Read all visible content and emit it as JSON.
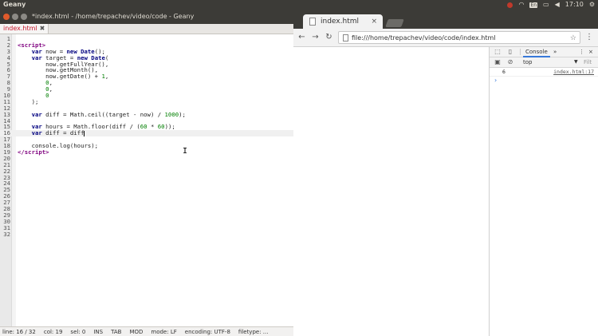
{
  "system": {
    "app_name": "Geany",
    "time": "17:10",
    "keyboard_layout": "En"
  },
  "geany": {
    "title": "*index.html - /home/trepachev/video/code - Geany",
    "tab_label": "index.html",
    "tab_close": "✖",
    "lines": [
      {
        "n": "1",
        "html": ""
      },
      {
        "n": "2",
        "html": "<span class='tagc'>&lt;script&gt;</span>"
      },
      {
        "n": "3",
        "html": "    <span class='kw'>var</span> now = <span class='kw'>new</span> <span class='kw'>Date</span>();"
      },
      {
        "n": "4",
        "html": "    <span class='kw'>var</span> target = <span class='kw'>new</span> <span class='kw'>Date</span>("
      },
      {
        "n": "5",
        "html": "        now.getFullYear(),"
      },
      {
        "n": "6",
        "html": "        now.getMonth(),"
      },
      {
        "n": "7",
        "html": "        now.getDate() + <span class='num'>1</span>,"
      },
      {
        "n": "8",
        "html": "        <span class='num'>0</span>,"
      },
      {
        "n": "9",
        "html": "        <span class='num'>0</span>,"
      },
      {
        "n": "10",
        "html": "        <span class='num'>0</span>"
      },
      {
        "n": "11",
        "html": "    );"
      },
      {
        "n": "12",
        "html": ""
      },
      {
        "n": "13",
        "html": "    <span class='kw'>var</span> diff = Math.ceil((target - now) / <span class='num'>1000</span>);"
      },
      {
        "n": "14",
        "html": ""
      },
      {
        "n": "15",
        "html": "    <span class='kw'>var</span> hours = Math.floor(diff / (<span class='num'>60</span> * <span class='num'>60</span>));"
      },
      {
        "n": "16",
        "html": "    <span class='kw'>var</span> diff = diff<span class='cursorbar'></span>",
        "current": true
      },
      {
        "n": "17",
        "html": ""
      },
      {
        "n": "18",
        "html": "    console.log(hours);"
      },
      {
        "n": "19",
        "html": "<span class='tagc'>&lt;/script&gt;</span>"
      },
      {
        "n": "20",
        "html": ""
      },
      {
        "n": "21",
        "html": ""
      },
      {
        "n": "22",
        "html": ""
      },
      {
        "n": "23",
        "html": ""
      },
      {
        "n": "24",
        "html": ""
      },
      {
        "n": "25",
        "html": ""
      },
      {
        "n": "26",
        "html": ""
      },
      {
        "n": "27",
        "html": ""
      },
      {
        "n": "28",
        "html": ""
      },
      {
        "n": "29",
        "html": ""
      },
      {
        "n": "30",
        "html": ""
      },
      {
        "n": "31",
        "html": ""
      },
      {
        "n": "32",
        "html": ""
      }
    ],
    "status": {
      "line": "line: 16 / 32",
      "col": "col: 19",
      "sel": "sel: 0",
      "ins": "INS",
      "tab": "TAB",
      "mod": "MOD",
      "mode": "mode: LF",
      "encoding": "encoding: UTF-8",
      "filetype": "filetype: ..."
    }
  },
  "chrome": {
    "tab_title": "index.html",
    "tab_close": "×",
    "url": "file:///home/trepachev/video/code/index.html",
    "devtools": {
      "tab_console": "Console",
      "more": "»",
      "menu_dots": "⋮",
      "close": "×",
      "context": "top",
      "filter_placeholder": "Filt",
      "log_value": "6",
      "log_source": "index.html:17",
      "prompt": "›"
    }
  }
}
